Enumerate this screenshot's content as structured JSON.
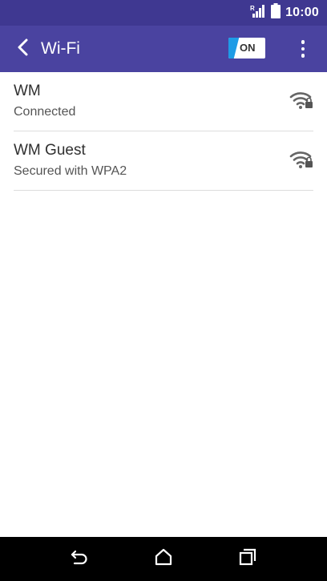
{
  "status_bar": {
    "time": "10:00",
    "icons": [
      "signal-icon",
      "battery-icon"
    ]
  },
  "app_bar": {
    "title": "Wi-Fi",
    "toggle_label": "ON",
    "colors": {
      "bar": "#4a43a0",
      "status_bar": "#3f3891",
      "toggle_accent": "#1e9be6"
    }
  },
  "networks": [
    {
      "name": "WM",
      "status": "Connected",
      "icon": "wifi-locked-icon"
    },
    {
      "name": "WM Guest",
      "status": "Secured with WPA2",
      "icon": "wifi-locked-icon"
    }
  ],
  "nav_bar": {
    "icons": [
      "back-icon",
      "home-icon",
      "recent-apps-icon"
    ]
  }
}
